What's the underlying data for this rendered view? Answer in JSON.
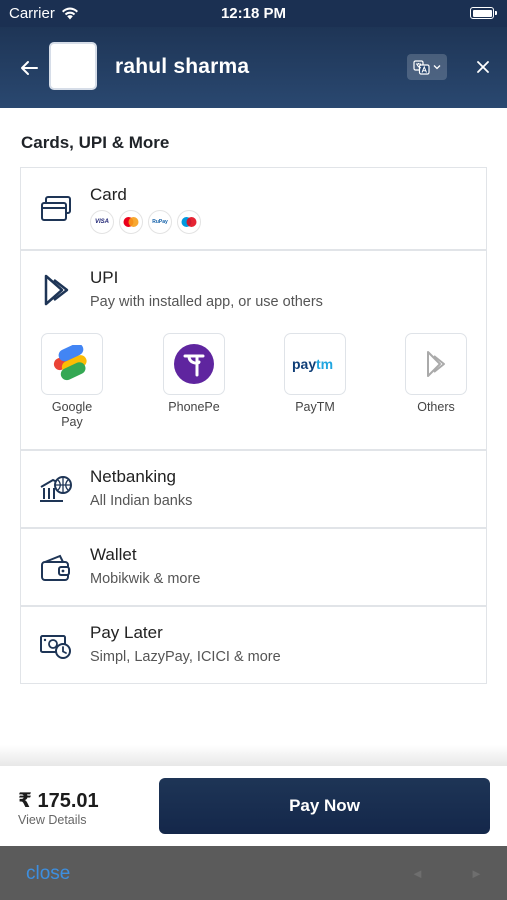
{
  "status": {
    "carrier": "Carrier",
    "time": "12:18 PM"
  },
  "header": {
    "merchant_name": "rahul sharma"
  },
  "section": {
    "title": "Cards, UPI & More"
  },
  "card": {
    "title": "Card",
    "networks": [
      "VISA",
      "Mastercard",
      "RuPay",
      "Maestro"
    ]
  },
  "upi": {
    "title": "UPI",
    "subtitle": "Pay with installed app, or use others",
    "apps": [
      {
        "label": "Google Pay"
      },
      {
        "label": "PhonePe"
      },
      {
        "label": "PayTM"
      },
      {
        "label": "Others"
      }
    ]
  },
  "netbanking": {
    "title": "Netbanking",
    "subtitle": "All Indian banks"
  },
  "wallet": {
    "title": "Wallet",
    "subtitle": "Mobikwik & more"
  },
  "paylater": {
    "title": "Pay Later",
    "subtitle": "Simpl, LazyPay, ICICI & more"
  },
  "footer": {
    "amount": "₹ 175.01",
    "view_details": "View Details",
    "pay_label": "Pay Now"
  },
  "webview": {
    "close_label": "close"
  },
  "colors": {
    "primary": "#1e3556",
    "link": "#3d8fe0"
  }
}
